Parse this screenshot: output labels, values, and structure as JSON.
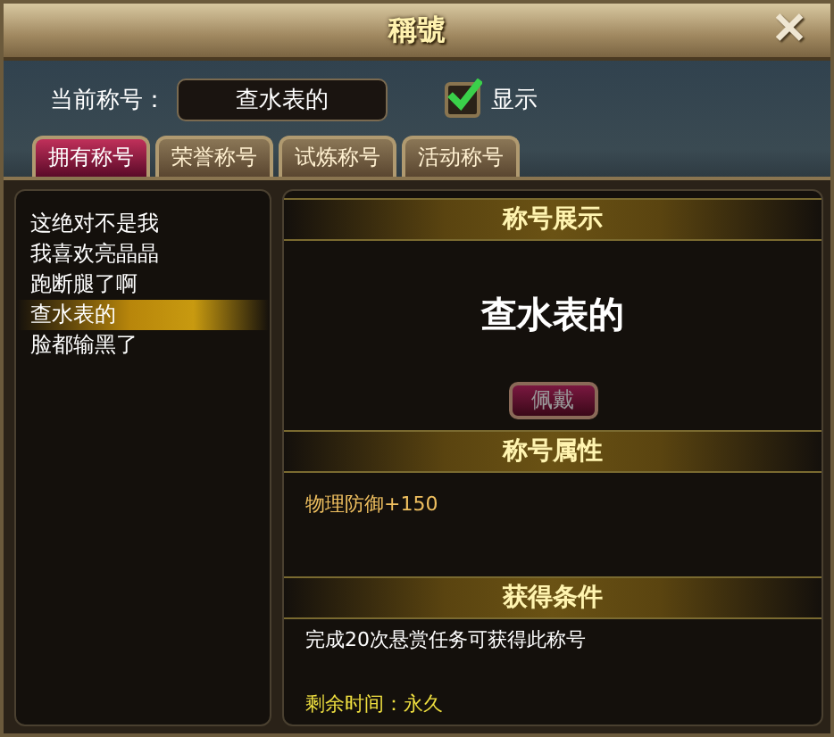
{
  "window": {
    "title": "稱號",
    "close": "✕"
  },
  "current": {
    "label": "当前称号：",
    "value": "查水表的",
    "show_label": "显示",
    "show_checked": true
  },
  "tabs": [
    {
      "label": "拥有称号",
      "selected": true
    },
    {
      "label": "荣誉称号",
      "selected": false
    },
    {
      "label": "试炼称号",
      "selected": false
    },
    {
      "label": "活动称号",
      "selected": false
    }
  ],
  "titles": [
    {
      "label": "这绝对不是我",
      "selected": false
    },
    {
      "label": "我喜欢亮晶晶",
      "selected": false
    },
    {
      "label": "跑断腿了啊",
      "selected": false
    },
    {
      "label": "查水表的",
      "selected": true
    },
    {
      "label": "脸都输黑了",
      "selected": false
    }
  ],
  "display": {
    "heading": "称号展示",
    "title": "查水表的",
    "button": "佩戴",
    "button_disabled": true
  },
  "attributes": {
    "heading": "称号属性",
    "text": "物理防御+150"
  },
  "conditions": {
    "heading": "获得条件",
    "text": "完成20次悬赏任务可获得此称号",
    "remaining": "剩余时间：永久"
  }
}
